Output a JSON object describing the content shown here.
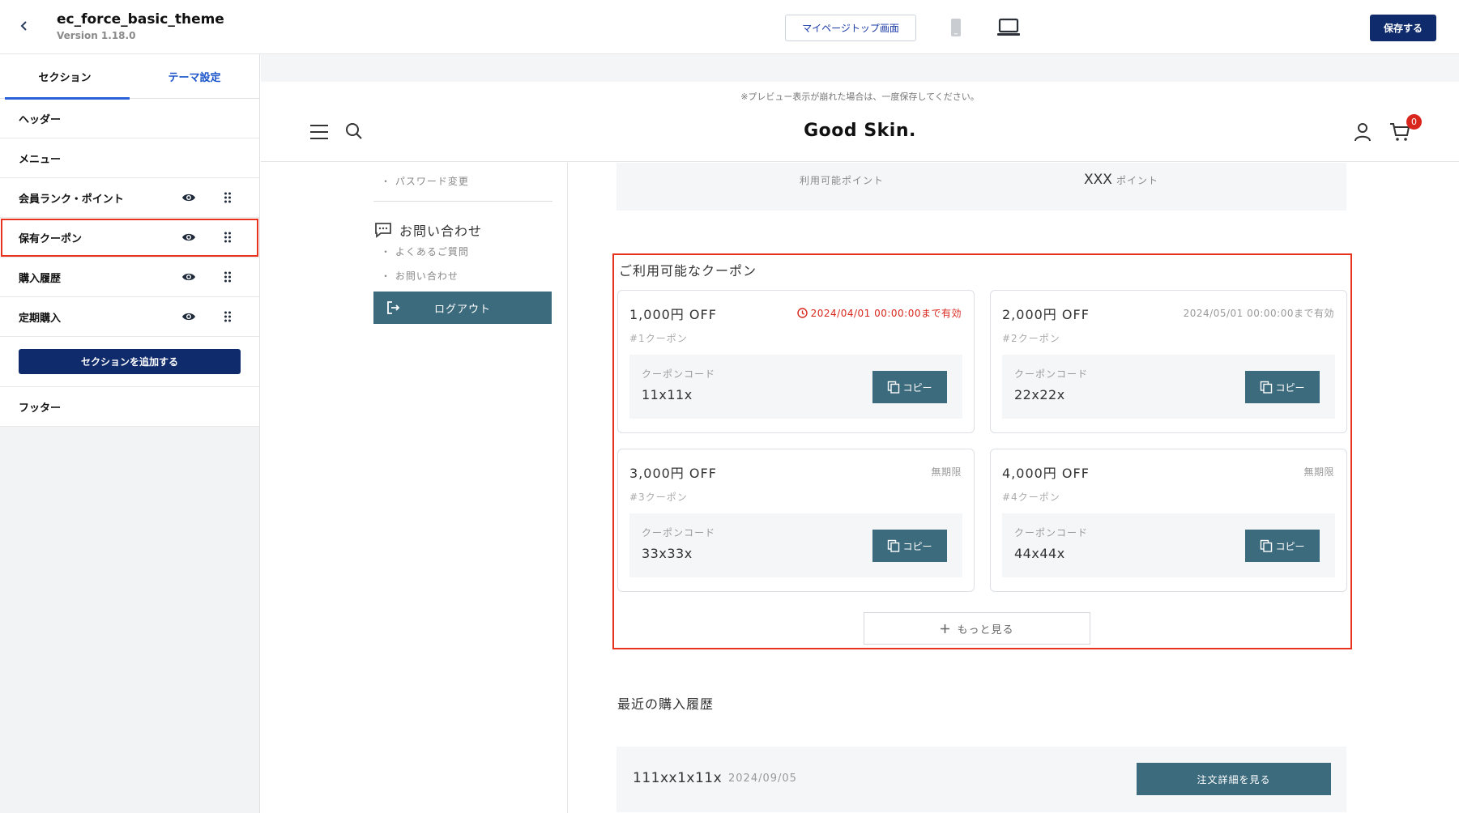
{
  "topbar": {
    "theme_name": "ec_force_basic_theme",
    "version": "Version 1.18.0",
    "mypage_button": "マイページトップ画面",
    "save_button": "保存する"
  },
  "sidebar": {
    "tabs": [
      {
        "label": "セクション",
        "active": true
      },
      {
        "label": "テーマ設定",
        "active": false
      }
    ],
    "items": [
      {
        "label": "ヘッダー"
      },
      {
        "label": "メニュー"
      },
      {
        "label": "会員ランク・ポイント"
      },
      {
        "label": "保有クーポン"
      },
      {
        "label": "購入履歴"
      },
      {
        "label": "定期購入"
      }
    ],
    "add_section_button": "セクションを追加する",
    "footer_item": "フッター"
  },
  "preview": {
    "note": "※プレビュー表示が崩れた場合は、一度保存してください。",
    "brand": "Good Skin.",
    "cart_count": "0",
    "nav": {
      "password_link": "・ パスワード変更",
      "contact_title": "お問い合わせ",
      "faq_link": "・ よくあるご質問",
      "contact_link": "・ お問い合わせ",
      "logout_button": "ログアウト"
    },
    "points": {
      "label": "利用可能ポイント",
      "value": "XXX",
      "unit": "ポイント"
    },
    "coupons": {
      "title": "ご利用可能なクーポン",
      "code_label": "クーポンコード",
      "copy_label": "コピー",
      "more_button": "もっと見る",
      "items": [
        {
          "amount": "1,000円 OFF",
          "expiry": "2024/04/01 00:00:00まで有効",
          "urgent": true,
          "name": "#1クーポン",
          "code": "11x11x"
        },
        {
          "amount": "2,000円 OFF",
          "expiry": "2024/05/01 00:00:00まで有効",
          "urgent": false,
          "name": "#2クーポン",
          "code": "22x22x"
        },
        {
          "amount": "3,000円 OFF",
          "expiry": "無期限",
          "urgent": false,
          "name": "#3クーポン",
          "code": "33x33x"
        },
        {
          "amount": "4,000円 OFF",
          "expiry": "無期限",
          "urgent": false,
          "name": "#4クーポン",
          "code": "44x44x"
        }
      ]
    },
    "history": {
      "title": "最近の購入履歴",
      "order_no": "111xx1x11x",
      "date": "2024/09/05",
      "detail_button": "注文詳細を見る"
    }
  },
  "colors": {
    "accent_navy": "#0f2b6b",
    "teal_button": "#3d6b7e",
    "highlight_red": "#e8321e",
    "badge_red": "#d9261c"
  }
}
